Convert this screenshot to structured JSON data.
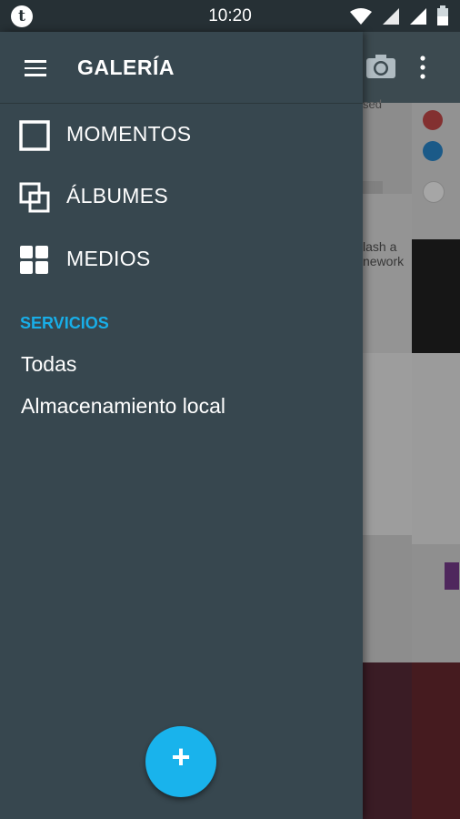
{
  "status_bar": {
    "time": "10:20",
    "app_icon_letter": "t"
  },
  "toolbar": {
    "title": "GALERÍA",
    "icons": [
      "menu-icon",
      "camera-icon",
      "more-vert-icon"
    ]
  },
  "drawer": {
    "nav_items": [
      {
        "label": "MOMENTOS",
        "icon": "moments-icon"
      },
      {
        "label": "ÁLBUMES",
        "icon": "albums-icon"
      },
      {
        "label": "MEDIOS",
        "icon": "media-grid-icon"
      }
    ],
    "section_header": "SERVICIOS",
    "services": [
      {
        "label": "Todas"
      },
      {
        "label": "Almacenamiento local"
      }
    ]
  },
  "background_fragments": {
    "text_1": "sed",
    "text_2": "lash a",
    "text_3": "nework"
  },
  "fab": {
    "label": "+",
    "icon": "add-icon"
  },
  "colors": {
    "drawer_bg": "#37474f",
    "accent": "#19b3ec",
    "section_header": "#18aee8",
    "status_bar": "#263035"
  }
}
